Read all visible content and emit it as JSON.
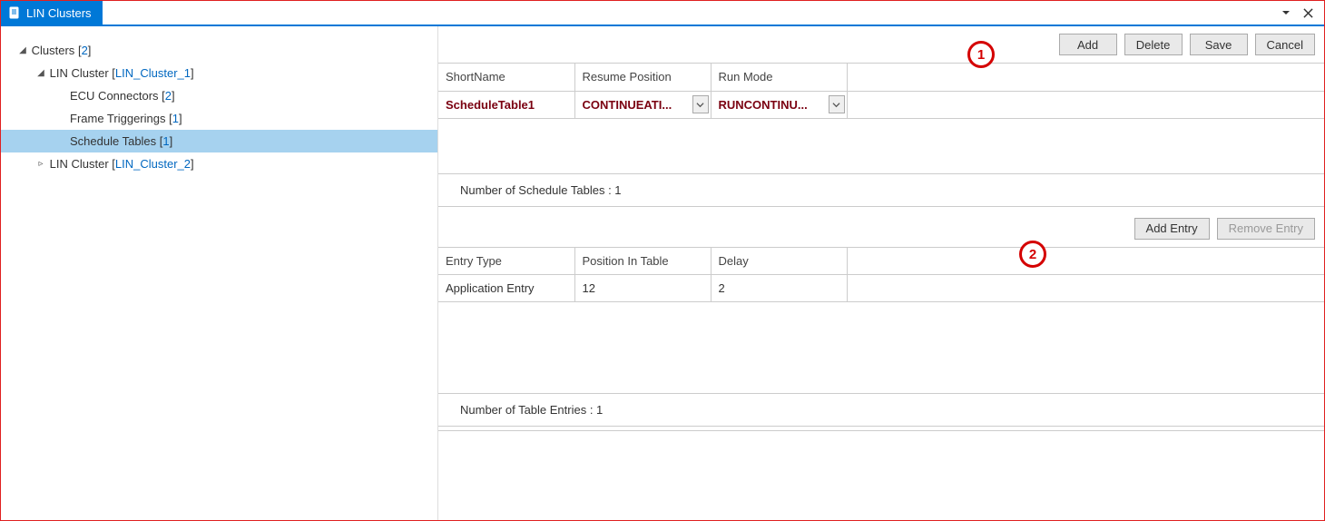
{
  "title": "LIN Clusters",
  "tree": {
    "root_label": "Clusters",
    "root_count": "2",
    "c1": {
      "label": "LIN Cluster",
      "link": "LIN_Cluster_1",
      "ecu_label": "ECU Connectors",
      "ecu_count": "2",
      "ft_label": "Frame Triggerings",
      "ft_count": "1",
      "st_label": "Schedule Tables",
      "st_count": "1"
    },
    "c2": {
      "label": "LIN Cluster",
      "link": "LIN_Cluster_2"
    }
  },
  "toolbar1": {
    "add": "Add",
    "delete": "Delete",
    "save": "Save",
    "cancel": "Cancel"
  },
  "grid1": {
    "headers": {
      "short": "ShortName",
      "resume": "Resume Position",
      "run": "Run Mode"
    },
    "row": {
      "short": "ScheduleTable1",
      "resume": "CONTINUEATI...",
      "run": "RUNCONTINU..."
    },
    "status": "Number of Schedule Tables : 1"
  },
  "toolbar2": {
    "add_entry": "Add Entry",
    "remove_entry": "Remove Entry"
  },
  "grid2": {
    "headers": {
      "type": "Entry Type",
      "pos": "Position In Table",
      "delay": "Delay"
    },
    "row": {
      "type": "Application Entry",
      "pos": "12",
      "delay": "2"
    },
    "status": "Number of Table Entries : 1"
  },
  "callouts": {
    "one": "1",
    "two": "2"
  }
}
